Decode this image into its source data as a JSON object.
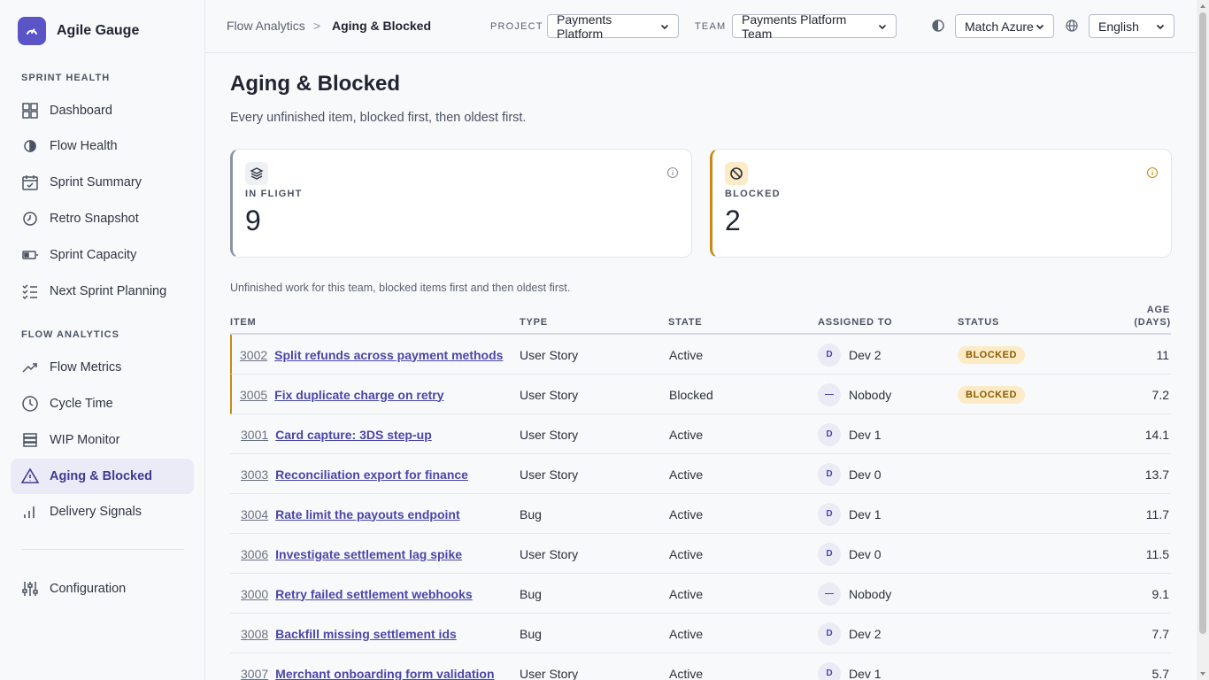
{
  "brand": {
    "name": "Agile Gauge"
  },
  "sidebar": {
    "sections": [
      {
        "title": "SPRINT HEALTH",
        "items": [
          {
            "label": "Dashboard",
            "icon": "grid-icon"
          },
          {
            "label": "Flow Health",
            "icon": "half-circle-icon"
          },
          {
            "label": "Sprint Summary",
            "icon": "calendar-check-icon"
          },
          {
            "label": "Retro Snapshot",
            "icon": "clock-icon"
          },
          {
            "label": "Sprint Capacity",
            "icon": "battery-icon"
          },
          {
            "label": "Next Sprint Planning",
            "icon": "checklist-icon"
          }
        ]
      },
      {
        "title": "FLOW ANALYTICS",
        "items": [
          {
            "label": "Flow Metrics",
            "icon": "trend-icon"
          },
          {
            "label": "Cycle Time",
            "icon": "clock-icon"
          },
          {
            "label": "WIP Monitor",
            "icon": "stack-icon"
          },
          {
            "label": "Aging & Blocked",
            "icon": "warning-icon",
            "active": true
          },
          {
            "label": "Delivery Signals",
            "icon": "bars-icon"
          }
        ]
      }
    ],
    "config": {
      "label": "Configuration",
      "icon": "sliders-icon"
    }
  },
  "header": {
    "breadcrumb": [
      "Flow Analytics",
      "Aging & Blocked"
    ],
    "breadcrumb_sep": ">",
    "project_label": "PROJECT",
    "project_value": "Payments Platform",
    "team_label": "TEAM",
    "team_value": "Payments Platform Team",
    "theme_value": "Match Azure",
    "language_value": "English"
  },
  "page": {
    "title": "Aging & Blocked",
    "subtitle": "Every unfinished item, blocked first, then oldest first."
  },
  "cards": [
    {
      "label": "IN FLIGHT",
      "value": "9",
      "icon": "layers-icon"
    },
    {
      "label": "BLOCKED",
      "value": "2",
      "icon": "blocked-icon"
    }
  ],
  "table": {
    "caption": "Unfinished work for this team, blocked items first and then oldest first.",
    "headers": {
      "item": "ITEM",
      "type": "TYPE",
      "state": "STATE",
      "assigned": "ASSIGNED TO",
      "status": "STATUS",
      "age_line1": "AGE",
      "age_line2": "(DAYS)"
    },
    "rows": [
      {
        "id": "3002",
        "title": "Split refunds across payment methods",
        "type": "User Story",
        "state": "Active",
        "avatar": "D",
        "assignee": "Dev 2",
        "status": "BLOCKED",
        "age": "11"
      },
      {
        "id": "3005",
        "title": "Fix duplicate charge on retry",
        "type": "User Story",
        "state": "Blocked",
        "avatar": "—",
        "assignee": "Nobody",
        "status": "BLOCKED",
        "age": "7.2"
      },
      {
        "id": "3001",
        "title": "Card capture: 3DS step-up",
        "type": "User Story",
        "state": "Active",
        "avatar": "D",
        "assignee": "Dev 1",
        "status": "",
        "age": "14.1"
      },
      {
        "id": "3003",
        "title": "Reconciliation export for finance",
        "type": "User Story",
        "state": "Active",
        "avatar": "D",
        "assignee": "Dev 0",
        "status": "",
        "age": "13.7"
      },
      {
        "id": "3004",
        "title": "Rate limit the payouts endpoint",
        "type": "Bug",
        "state": "Active",
        "avatar": "D",
        "assignee": "Dev 1",
        "status": "",
        "age": "11.7"
      },
      {
        "id": "3006",
        "title": "Investigate settlement lag spike",
        "type": "User Story",
        "state": "Active",
        "avatar": "D",
        "assignee": "Dev 0",
        "status": "",
        "age": "11.5"
      },
      {
        "id": "3000",
        "title": "Retry failed settlement webhooks",
        "type": "Bug",
        "state": "Active",
        "avatar": "—",
        "assignee": "Nobody",
        "status": "",
        "age": "9.1"
      },
      {
        "id": "3008",
        "title": "Backfill missing settlement ids",
        "type": "Bug",
        "state": "Active",
        "avatar": "D",
        "assignee": "Dev 2",
        "status": "",
        "age": "7.7"
      },
      {
        "id": "3007",
        "title": "Merchant onboarding form validation",
        "type": "User Story",
        "state": "Active",
        "avatar": "D",
        "assignee": "Dev 1",
        "status": "",
        "age": "5.7"
      }
    ]
  },
  "colors": {
    "accent": "#5b54c7",
    "blocked": "#c98a12",
    "badge_bg": "#fcebc6"
  }
}
